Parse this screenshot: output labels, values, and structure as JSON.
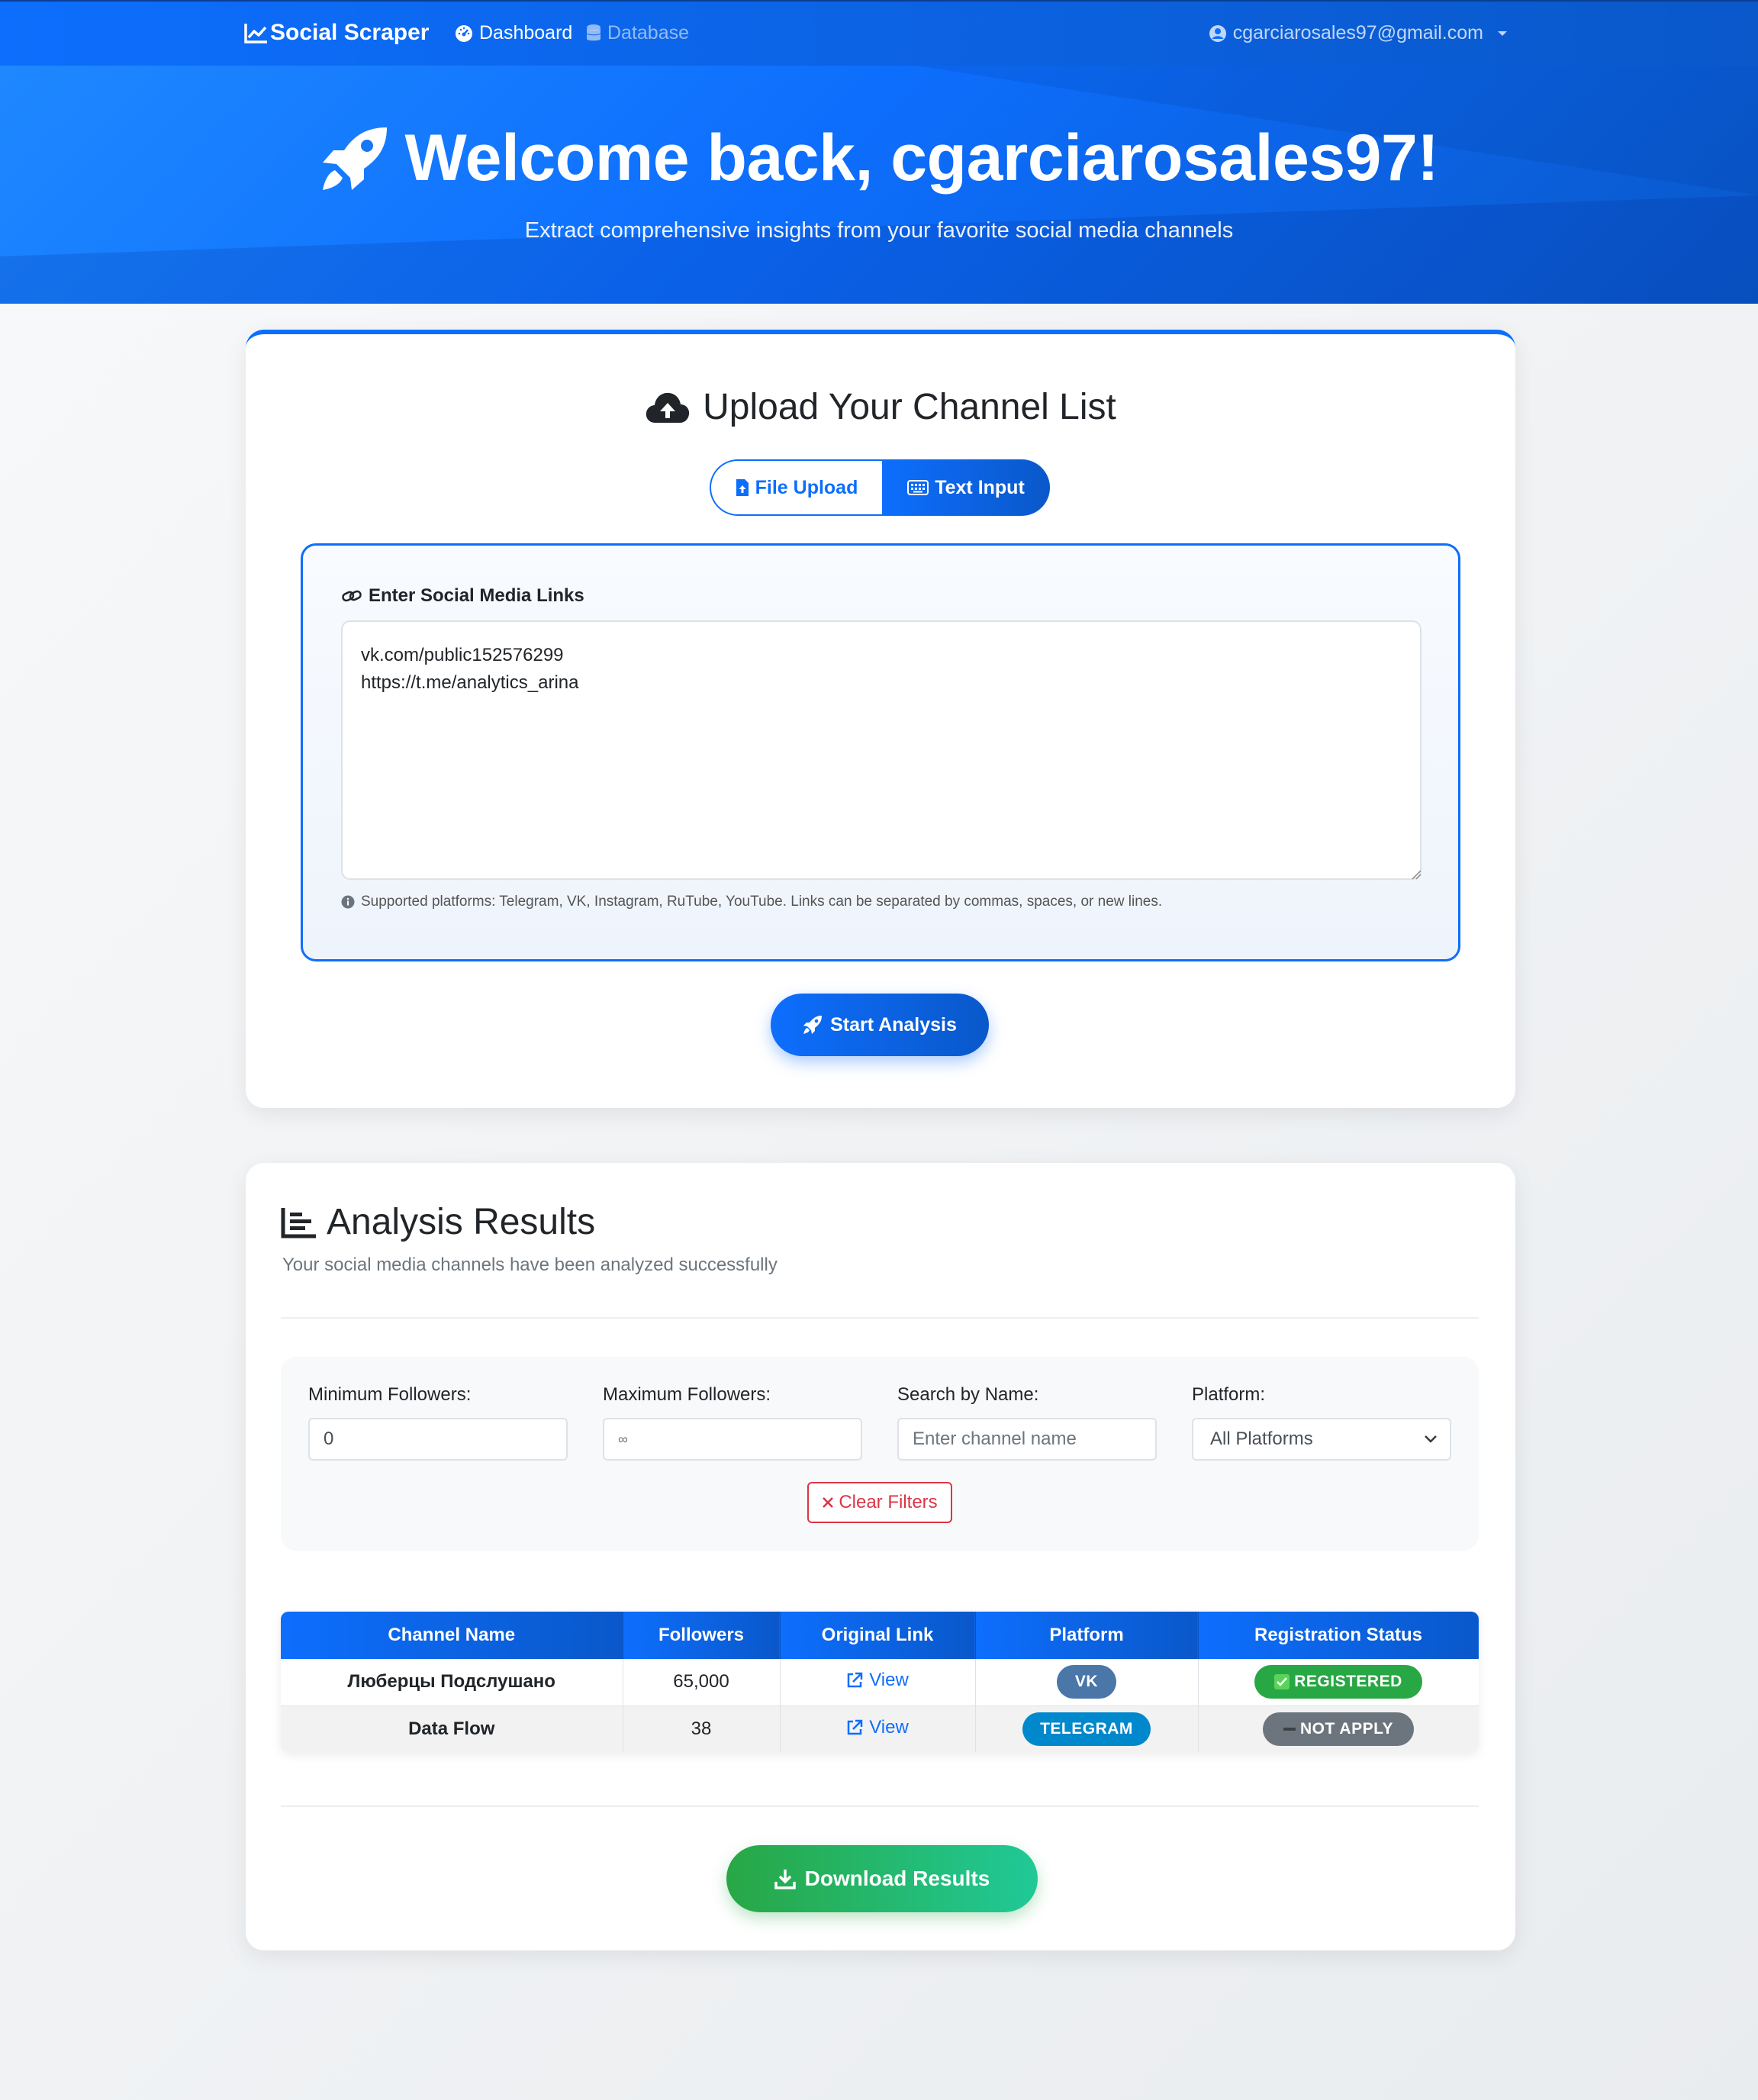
{
  "navbar": {
    "brand": "Social Scraper",
    "links": [
      {
        "label": "Dashboard",
        "icon": "tachometer-icon"
      },
      {
        "label": "Database",
        "icon": "database-icon"
      }
    ],
    "user_email": "cgarciarosales97@gmail.com"
  },
  "hero": {
    "title": "Welcome back, cgarciarosales97!",
    "subtitle": "Extract comprehensive insights from your favorite social media channels"
  },
  "upload": {
    "title": "Upload Your Channel List",
    "tabs": [
      "File Upload",
      "Text Input"
    ],
    "active_tab": "Text Input",
    "input_label": "Enter Social Media Links",
    "textarea_value": "vk.com/public152576299\nhttps://t.me/analytics_arina",
    "help_text": "Supported platforms: Telegram, VK, Instagram, RuTube, YouTube. Links can be separated by commas, spaces, or new lines.",
    "start_button": "Start Analysis"
  },
  "results": {
    "title": "Analysis Results",
    "subtitle": "Your social media channels have been analyzed successfully",
    "filters": {
      "min_label": "Minimum Followers:",
      "min_value": "0",
      "max_label": "Maximum Followers:",
      "max_placeholder": "∞",
      "search_label": "Search by Name:",
      "search_placeholder": "Enter channel name",
      "platform_label": "Platform:",
      "platform_value": "All Platforms",
      "clear_button": "Clear Filters"
    },
    "table": {
      "headers": [
        "Channel Name",
        "Followers",
        "Original Link",
        "Platform",
        "Registration Status"
      ],
      "rows": [
        {
          "name": "Люберцы Подслушано",
          "followers": "65,000",
          "link": "View",
          "platform": "VK",
          "status": "REGISTERED"
        },
        {
          "name": "Data Flow",
          "followers": "38",
          "link": "View",
          "platform": "TELEGRAM",
          "status": "NOT APPLY"
        }
      ]
    },
    "download_button": "Download Results"
  },
  "colors": {
    "primary": "#0d6efd",
    "success": "#28a745",
    "danger": "#dc3545",
    "vk": "#4a76a8",
    "telegram": "#0088cc",
    "muted": "#6c757d"
  }
}
